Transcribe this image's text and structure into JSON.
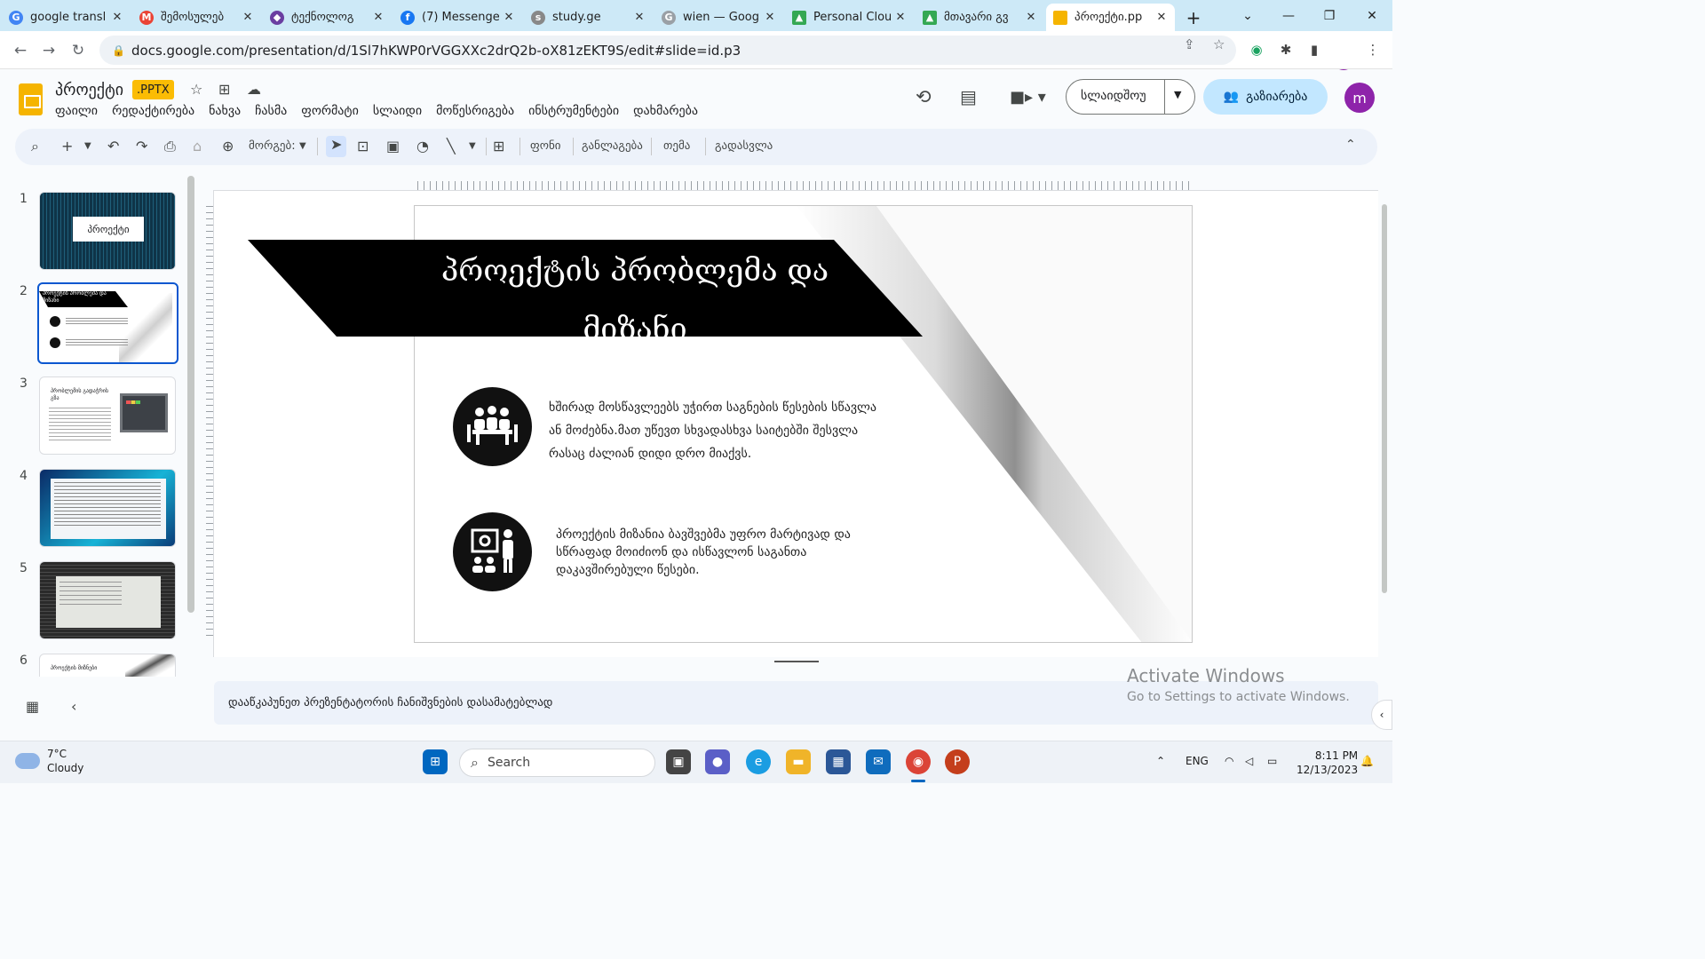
{
  "browser": {
    "tabs": [
      {
        "title": "google transl",
        "favicon": "google-g",
        "color": "#4285f4"
      },
      {
        "title": "შემოსულებ",
        "favicon": "gmail",
        "color": "#ea4335"
      },
      {
        "title": "ტექნოლოგ",
        "favicon": "shield-purple",
        "color": "#6a3ea1"
      },
      {
        "title": "(7) Messenge",
        "favicon": "facebook",
        "color": "#1877f2"
      },
      {
        "title": "study.ge",
        "favicon": "study",
        "color": "#666666"
      },
      {
        "title": "wien — Goog",
        "favicon": "google-search",
        "color": "#5f6368"
      },
      {
        "title": "Personal Clou",
        "favicon": "drive",
        "color": "#34a853"
      },
      {
        "title": "მთავარი გვ",
        "favicon": "drive",
        "color": "#34a853"
      },
      {
        "title": "პროექტი.pp",
        "favicon": "slides",
        "color": "#f5b400",
        "active": true
      }
    ],
    "close_glyph": "✕",
    "new_tab": "+",
    "url": "docs.google.com/presentation/d/1Sl7hKWP0rVGGXXc2drQ2b-oX81zEKT9S/edit#slide=id.p3",
    "profile_initial": "m"
  },
  "doc": {
    "title": "პროექტი",
    "badge": ".PPTX",
    "menu": [
      "ფაილი",
      "რედაქტირება",
      "ნახვა",
      "ჩასმა",
      "ფორმატი",
      "სლაიდი",
      "მოწესრიგება",
      "ინსტრუმენტები",
      "დახმარება"
    ],
    "slideshow_label": "სლაიდშოუ",
    "share_label": "გაზიარება",
    "user_initial": "m"
  },
  "toolbar": {
    "zoom_label": "მორგებ:",
    "background": "ფონი",
    "layout": "განლაგება",
    "theme": "თემა",
    "transition": "გადასვლა"
  },
  "filmstrip": {
    "numbers": [
      "1",
      "2",
      "3",
      "4",
      "5",
      "6"
    ],
    "slide1_title": "პროექტი",
    "slide2_title": "პროექტის პრობლემა და მიზანი",
    "slide3_title": "პრობლემის გადაჭრის გზა",
    "slide6_title": "პროექტის მიზნები",
    "active_index": 2
  },
  "slide": {
    "title_line1": "პროექტის პრობლემა და",
    "title_line2": "მიზანი",
    "para1_line1": "ხშირად მოსწავლეებს უჭირთ საგნების წესების სწავლა",
    "para1_line2": "ან მოძებნა.მათ უწევთ სხვადასხვა საიტებში შესვლა",
    "para1_line3": "რასაც ძალიან დიდი დრო მიაქვს.",
    "para2_line1": "პროექტის მიზანია ბავშვებმა უფრო მარტივად და",
    "para2_line2": "სწრაფად მოიძიონ და ისწავლონ საგანთა",
    "para2_line3": "დაკავშირებული წესები."
  },
  "notes_placeholder": "დააწკაპუნეთ პრეზენტატორის ჩანიშვნების დასამატებლად",
  "watermark": {
    "line1": "Activate Windows",
    "line2": "Go to Settings to activate Windows."
  },
  "taskbar": {
    "temp": "7°C",
    "condition": "Cloudy",
    "search_placeholder": "Search",
    "lang": "ENG",
    "time": "8:11 PM",
    "date": "12/13/2023"
  }
}
